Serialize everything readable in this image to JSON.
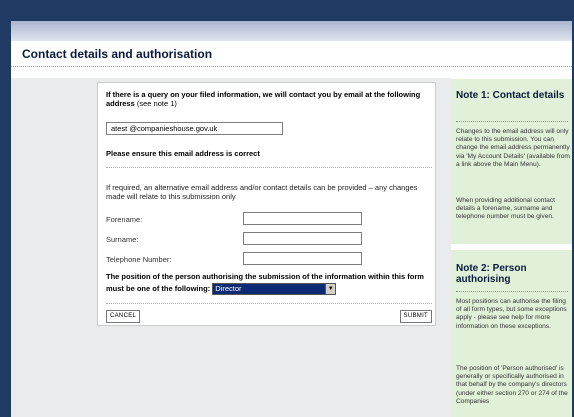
{
  "page": {
    "title": "Contact details and authorisation"
  },
  "form": {
    "intro_bold": "If there is a query on your filed information, we will contact you by email at the following address",
    "intro_note": "(see note 1)",
    "email_value": "atest @companieshouse.gov.uk",
    "ensure_text": "Please ensure this email address is correct",
    "alternative_text": "If required, an alternative email address and/or contact details can be provided – any changes made will relate to this submission only",
    "forename_label": "Forename:",
    "surname_label": "Surname:",
    "telephone_label": "Telephone Number:",
    "forename_value": "",
    "surname_value": "",
    "telephone_value": "",
    "position_text_1": "The position of the person authorising the submission of the information within this form",
    "position_text_2": "must be one of the following:",
    "position_selected": "Director",
    "cancel_label": "CANCEL",
    "submit_label": "SUBMIT"
  },
  "notes": {
    "note1": {
      "title": "Note 1: Contact details",
      "para1": "Changes to the email address will only relate to this submission. You can change the email address permanently via 'My Account Details' (available from a link above the Main Menu).",
      "para2": "When providing additional contact details a forename, surname and telephone number must be given."
    },
    "note2": {
      "title": "Note 2: Person authorising",
      "para1": "Most positions can authorise the filing of all form types, but some exceptions apply - please see help for more information on these exceptions.",
      "para2": "The position of 'Person authorised' is generally or specifically authorised in that behalf by the company's directors (under either section 270 or 274 of the Companies"
    }
  },
  "colors": {
    "frame": "#1f3a63",
    "notes_bg": "#e0f0d9",
    "select_bg": "#0f2a74"
  }
}
